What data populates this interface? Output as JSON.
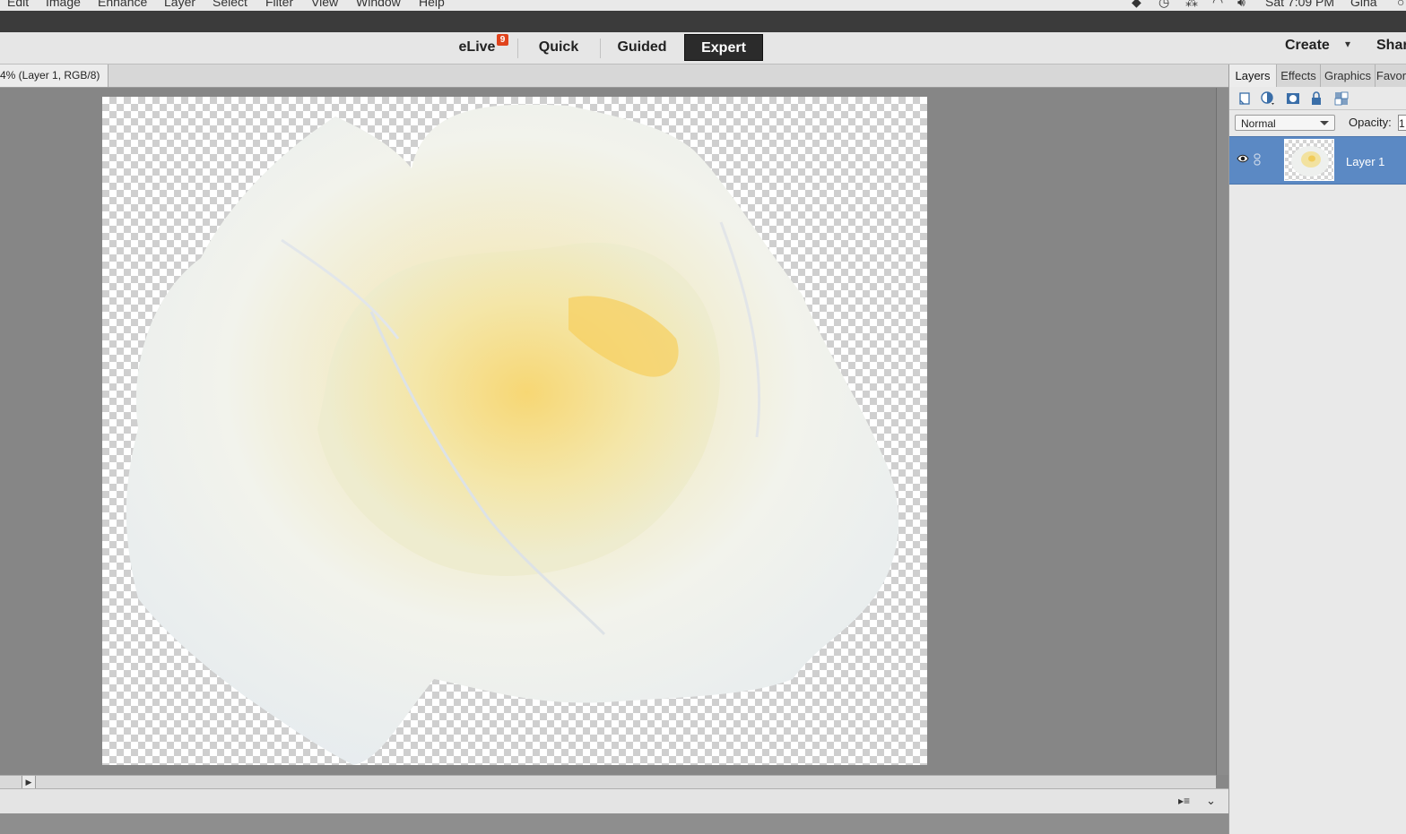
{
  "menu_bar": {
    "items": [
      "Edit",
      "Image",
      "Enhance",
      "Layer",
      "Select",
      "Filter",
      "View",
      "Window",
      "Help"
    ],
    "clock": "Sat 7:09 PM",
    "user": "Gina"
  },
  "mode_bar": {
    "tabs": [
      {
        "label": "eLive",
        "badge": "9"
      },
      {
        "label": "Quick"
      },
      {
        "label": "Guided"
      },
      {
        "label": "Expert",
        "active": true
      }
    ],
    "create_label": "Create",
    "share_label": "Shar"
  },
  "document": {
    "tab_title": "4% (Layer 1, RGB/8)"
  },
  "panel": {
    "tabs": [
      "Layers",
      "Effects",
      "Graphics",
      "Favor"
    ],
    "blend_mode": "Normal",
    "opacity_label": "Opacity:",
    "opacity_value": "1",
    "layers": [
      {
        "name": "Layer 1",
        "visible": true,
        "selected": true
      }
    ]
  },
  "colors": {
    "accent_selected": "#5b89c4",
    "elive_badge": "#e0431c",
    "expert_tab": "#2b2b2b"
  }
}
